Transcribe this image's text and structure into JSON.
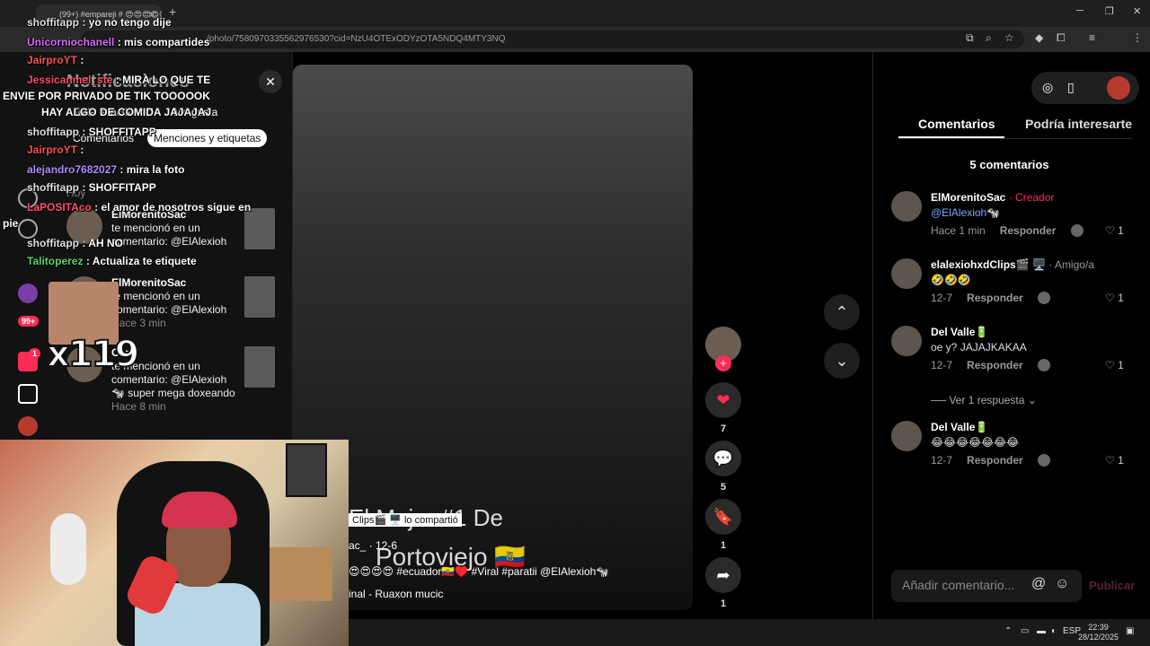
{
  "browser": {
    "tab_title": "(99+) #empareji # 😍😍😍😍😍",
    "url": "/photo/7580970335562976530?cid=NzU4OTExODYzOTA5NDQ4MTY3NQ",
    "win_min": "─",
    "win_max": "❐",
    "win_close": "✕",
    "new_tab": "+"
  },
  "nav": {
    "badge_messages": "99+",
    "badge_inbox": "1"
  },
  "notifications": {
    "title": "Notificaciones",
    "close": "✕",
    "filters": [
      "Toda la actividad",
      "Me gusta",
      "Comentarios",
      "Menciones y etiquetas"
    ],
    "day": "Hoy",
    "items": [
      {
        "who": "ElMorenitoSac",
        "text": "te mencionó en un comentario: @ElAlexioh",
        "time": ""
      },
      {
        "who": "ElMorenitoSac",
        "text": "te mencionó en un comentario: @ElAlexioh",
        "time": "Hace 3 min"
      },
      {
        "who": "Camí",
        "text": "te mencionó en un comentario: @ElAlexioh 🐄 super mega doxeando",
        "time": "Hace 8 min"
      }
    ]
  },
  "chat": [
    {
      "user": "shoffitapp",
      "msg": ": yo no tengo dije",
      "color": "#e0e0e0"
    },
    {
      "user": "Unicorniochanell",
      "msg": ": mis compartides",
      "color": "#d96bff"
    },
    {
      "user": "JairproYT",
      "msg": ":",
      "color": "#ff5050"
    },
    {
      "user": "Jessicanmel_ste",
      "msg": ": MIRA LO QUE TE",
      "color": "#ff4d6d"
    },
    {
      "user": "",
      "msg": "ENVIE POR PRIVADO DE TIK TOOOOOK",
      "color": "#ffffff"
    },
    {
      "user": "",
      "msg": "HAY ALGO DE COMIDA JAJAJAJ",
      "color": "#ffffff"
    },
    {
      "user": "shoffitapp",
      "msg": ": SHOFFITAPP",
      "color": "#e0e0e0"
    },
    {
      "user": "JairproYT",
      "msg": ":",
      "color": "#ff5050"
    },
    {
      "user": "alejandro7682027",
      "msg": ": mira la foto",
      "color": "#b18cff"
    },
    {
      "user": "shoffitapp",
      "msg": ": SHOFFITAPP",
      "color": "#e0e0e0"
    },
    {
      "user": "LaPOSITAco",
      "msg": ": el amor de nosotros sigue en",
      "color": "#ff4d6d"
    },
    {
      "user": "",
      "msg": "pie",
      "color": "#ffffff"
    },
    {
      "user": "shoffitapp",
      "msg": ": AH NO",
      "color": "#e0e0e0"
    },
    {
      "user": "Talitoperez",
      "msg": ": Actualiza te etiquete",
      "color": "#5fd36b"
    }
  ],
  "emote": {
    "multiplier": "x119"
  },
  "video": {
    "title_line1": "El Mejor #1 De",
    "title_line2": "Portoviejo 🇪🇨",
    "shared": "Clips🎬 🖥️ lo compartió",
    "author": "ac_ · 12-6",
    "caption": "😍😍😍😍 #ecuador🇪🇨♥️ #Viral #paratii @ElAlexioh🐄",
    "music": "inal - Ruaxon mucic"
  },
  "rail": {
    "likes": "7",
    "comments": "5",
    "saves": "1",
    "shares": "1"
  },
  "comments_panel": {
    "tabs": [
      "Comentarios",
      "Podría interesarte"
    ],
    "count": "5 comentarios",
    "comments": [
      {
        "name": "ElMorenitoSac",
        "tag": "· Creador",
        "text": "",
        "mention": "@ElAlexioh🐄",
        "time": "Hace 1 min",
        "reply": "Responder",
        "likes": "1"
      },
      {
        "name": "elalexiohxdClips🎬 🖥️",
        "tag": "· Amigo/a",
        "text": "🤣🤣🤣",
        "mention": "",
        "time": "12-7",
        "reply": "Responder",
        "likes": "1"
      },
      {
        "name": "Del Valle🔋",
        "tag": "",
        "text": "oe y? JAJAJKAKAA",
        "mention": "",
        "time": "12-7",
        "reply": "Responder",
        "likes": "1"
      },
      {
        "name": "Del Valle🔋",
        "tag": "",
        "text": "😂😂😂😂😂😂😂",
        "mention": "",
        "time": "12-7",
        "reply": "Responder",
        "likes": "1"
      }
    ],
    "more_replies": "Ver 1 respuesta ⌄",
    "input_placeholder": "Añadir comentario...",
    "publish": "Publicar"
  },
  "taskbar": {
    "lang": "ESP",
    "time": "22:39",
    "date": "28/12/2025"
  },
  "colors": {
    "accent": "#fe2c55",
    "mention": "#7aa8ff"
  }
}
